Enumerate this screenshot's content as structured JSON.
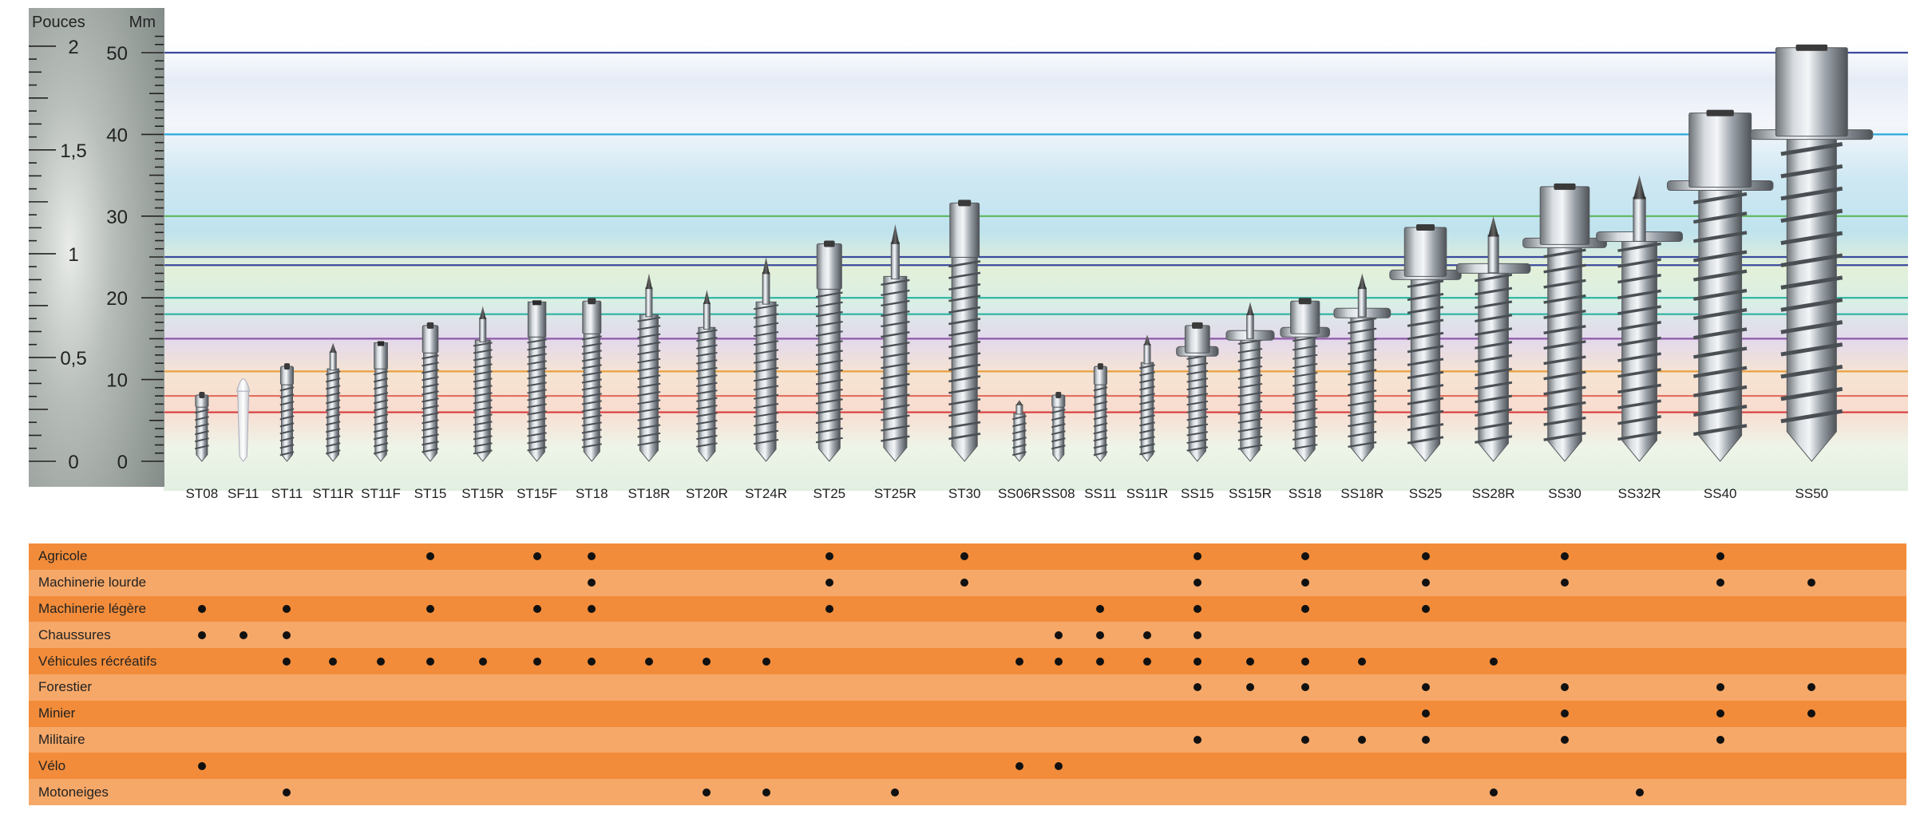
{
  "chart_data": {
    "type": "table",
    "axis_left_label": "Pouces",
    "axis_right_label": "Mm",
    "inch_ticks": [
      {
        "value": 0,
        "label": "0"
      },
      {
        "value": 0.5,
        "label": "0,5"
      },
      {
        "value": 1,
        "label": "1"
      },
      {
        "value": 1.5,
        "label": "1,5"
      },
      {
        "value": 2,
        "label": "2"
      }
    ],
    "mm_ticks": [
      {
        "value": 0,
        "label": "0"
      },
      {
        "value": 10,
        "label": "10"
      },
      {
        "value": 20,
        "label": "20"
      },
      {
        "value": 30,
        "label": "30"
      },
      {
        "value": 40,
        "label": "40"
      },
      {
        "value": 50,
        "label": "50"
      }
    ],
    "ylim_mm": [
      0,
      50
    ],
    "reference_lines": [
      {
        "mm": 50,
        "color": "#3b4a9e"
      },
      {
        "mm": 40,
        "color": "#29a9dd"
      },
      {
        "mm": 30,
        "color": "#5cb85c"
      },
      {
        "mm": 25,
        "color": "#3b4a9e"
      },
      {
        "mm": 24,
        "color": "#3b4a9e"
      },
      {
        "mm": 20,
        "color": "#2bb3a0"
      },
      {
        "mm": 18,
        "color": "#2bb3a0"
      },
      {
        "mm": 15,
        "color": "#8e5aa8"
      },
      {
        "mm": 11,
        "color": "#e8a040"
      },
      {
        "mm": 8,
        "color": "#e07060"
      },
      {
        "mm": 6,
        "color": "#d43d3d"
      }
    ],
    "models": [
      {
        "name": "ST08",
        "height_mm": 8.5,
        "head": "hex"
      },
      {
        "name": "SF11",
        "height_mm": 11,
        "head": "plastic"
      },
      {
        "name": "ST11",
        "height_mm": 12,
        "head": "hex"
      },
      {
        "name": "ST11R",
        "height_mm": 14.5,
        "head": "pin"
      },
      {
        "name": "ST11F",
        "height_mm": 14.5,
        "head": "flat"
      },
      {
        "name": "ST15",
        "height_mm": 17,
        "head": "hex"
      },
      {
        "name": "ST15R",
        "height_mm": 19,
        "head": "pin"
      },
      {
        "name": "ST15F",
        "height_mm": 19.5,
        "head": "flat"
      },
      {
        "name": "ST18",
        "height_mm": 20,
        "head": "hex"
      },
      {
        "name": "ST18R",
        "height_mm": 23,
        "head": "pin"
      },
      {
        "name": "ST20R",
        "height_mm": 21,
        "head": "pin"
      },
      {
        "name": "ST24R",
        "height_mm": 25,
        "head": "pin"
      },
      {
        "name": "ST25",
        "height_mm": 27,
        "head": "hex"
      },
      {
        "name": "ST25R",
        "height_mm": 29,
        "head": "pin"
      },
      {
        "name": "ST30",
        "height_mm": 32,
        "head": "hex"
      },
      {
        "name": "SS06R",
        "height_mm": 7.5,
        "head": "pin"
      },
      {
        "name": "SS08",
        "height_mm": 8.5,
        "head": "hex"
      },
      {
        "name": "SS11",
        "height_mm": 12,
        "head": "hex"
      },
      {
        "name": "SS11R",
        "height_mm": 15.5,
        "head": "pin"
      },
      {
        "name": "SS15",
        "height_mm": 17,
        "head": "flange"
      },
      {
        "name": "SS15R",
        "height_mm": 19.5,
        "head": "flangepin"
      },
      {
        "name": "SS18",
        "height_mm": 20,
        "head": "flange"
      },
      {
        "name": "SS18R",
        "height_mm": 23,
        "head": "flangepin"
      },
      {
        "name": "SS25",
        "height_mm": 29,
        "head": "flange"
      },
      {
        "name": "SS28R",
        "height_mm": 30,
        "head": "flangepin"
      },
      {
        "name": "SS30",
        "height_mm": 34,
        "head": "flange"
      },
      {
        "name": "SS32R",
        "height_mm": 35,
        "head": "flangepin"
      },
      {
        "name": "SS40",
        "height_mm": 43,
        "head": "flange"
      },
      {
        "name": "SS50",
        "height_mm": 51,
        "head": "flange"
      }
    ],
    "applications": [
      {
        "name": "Agricole",
        "models": [
          "ST15",
          "ST15F",
          "ST18",
          "ST25",
          "ST30",
          "SS15",
          "SS18",
          "SS25",
          "SS30",
          "SS40"
        ]
      },
      {
        "name": "Machinerie lourde",
        "models": [
          "ST18",
          "ST25",
          "ST30",
          "SS15",
          "SS18",
          "SS25",
          "SS30",
          "SS40",
          "SS50"
        ]
      },
      {
        "name": "Machinerie légère",
        "models": [
          "ST08",
          "ST11",
          "ST15",
          "ST15F",
          "ST18",
          "ST25",
          "SS11",
          "SS15",
          "SS18",
          "SS25"
        ]
      },
      {
        "name": "Chaussures",
        "models": [
          "ST08",
          "SF11",
          "ST11",
          "SS08",
          "SS11",
          "SS11R",
          "SS15"
        ]
      },
      {
        "name": "Véhicules récréatifs",
        "models": [
          "ST11",
          "ST11R",
          "ST11F",
          "ST15",
          "ST15R",
          "ST15F",
          "ST18",
          "ST18R",
          "ST20R",
          "ST24R",
          "SS06R",
          "SS08",
          "SS11",
          "SS11R",
          "SS15",
          "SS15R",
          "SS18",
          "SS18R",
          "SS28R"
        ]
      },
      {
        "name": "Forestier",
        "models": [
          "SS15",
          "SS15R",
          "SS18",
          "SS25",
          "SS30",
          "SS40",
          "SS50"
        ]
      },
      {
        "name": "Minier",
        "models": [
          "SS25",
          "SS30",
          "SS40",
          "SS50"
        ]
      },
      {
        "name": "Militaire",
        "models": [
          "SS15",
          "SS18",
          "SS18R",
          "SS25",
          "SS30",
          "SS40"
        ]
      },
      {
        "name": "Vélo",
        "models": [
          "ST08",
          "SS06R",
          "SS08"
        ]
      },
      {
        "name": "Motoneiges",
        "models": [
          "ST11",
          "ST20R",
          "ST24R",
          "ST25R",
          "SS28R",
          "SS32R"
        ]
      }
    ]
  }
}
